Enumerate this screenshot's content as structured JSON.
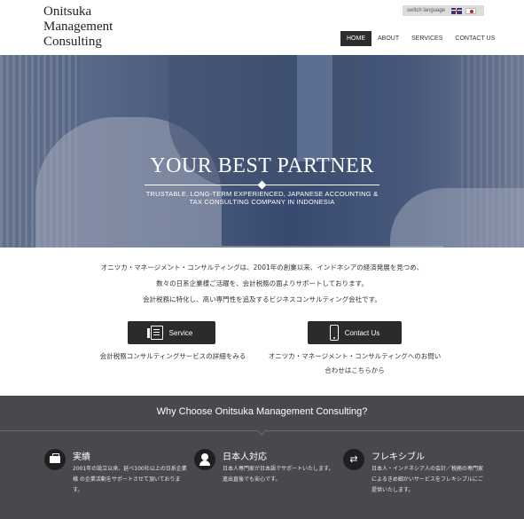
{
  "header": {
    "logo_lines": [
      "Onitsuka",
      "Management",
      "Consulting"
    ],
    "switch_language_label": "switch language",
    "nav": [
      {
        "label": "HOME",
        "active": true
      },
      {
        "label": "ABOUT",
        "active": false
      },
      {
        "label": "SERVICES",
        "active": false
      },
      {
        "label": "CONTACT US",
        "active": false
      }
    ]
  },
  "hero": {
    "title": "YOUR BEST PARTNER",
    "subtitle_line1": "TRUSTABLE, LONG-TERM EXPERIENCED, JAPANESE ACCOUNTING &",
    "subtitle_line2": "TAX CONSULTING COMPANY IN INDONESIA"
  },
  "intro": {
    "lines": [
      "オニツカ・マネージメント・コンサルティングは、2001年の創業以来、インドネシアの経済発展を見つめ、",
      "数々の日系企業様ご活躍を、会計税務の面よりサポートしております。",
      "会計税務に特化し、高い専門性を追及するビジネスコンサルティング会社です。"
    ]
  },
  "cta": {
    "service_label": "Service",
    "service_desc": "会計税務コンサルティングサービスの詳細をみる",
    "contact_label": "Contact Us",
    "contact_desc_line1": "オニツカ・マネージメント・コンサルティングへのお問い",
    "contact_desc_line2": "合わせはこちらから"
  },
  "why": {
    "title": "Why Choose Onitsuka Management Consulting?",
    "features": [
      {
        "icon": "briefcase-icon",
        "title": "実績",
        "text": "2001年の設立以来、延べ100社以上の日系企業様 の企業活動をサポートさせて頂いております。"
      },
      {
        "icon": "person-icon",
        "title": "日本人対応",
        "text": "日本人専門家が日本語でサポートいたします。進出直後でも安心です。"
      },
      {
        "icon": "shuffle-icon",
        "title": "フレキシブル",
        "text": "日本人・インドネシア人の会計／税務の専門家によるきめ細かいサービスをフレキシブルにご提供いたします。"
      }
    ]
  }
}
